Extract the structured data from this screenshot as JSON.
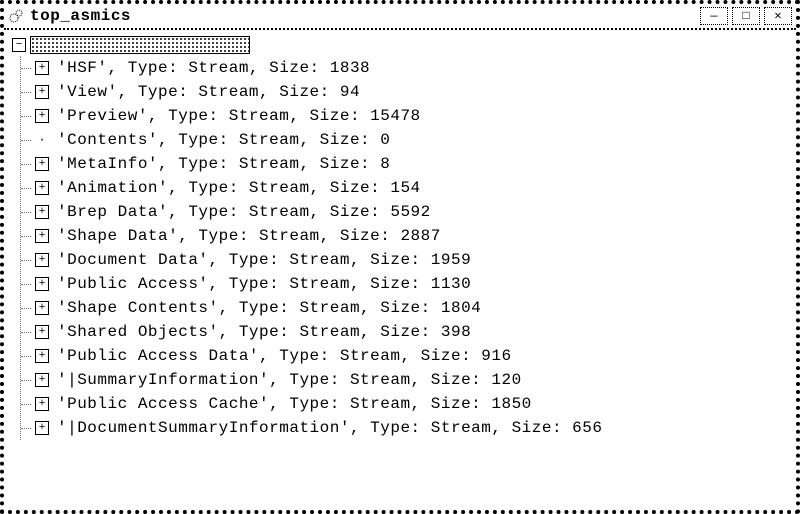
{
  "window": {
    "title": "top_asmics",
    "controls": {
      "min_glyph": "—",
      "max_glyph": "□",
      "close_glyph": "✕"
    }
  },
  "tree": {
    "root": {
      "expanded": true,
      "label": ""
    },
    "type_label": "Type",
    "size_label": "Size",
    "default_type": "Stream",
    "items": [
      {
        "name": "HSF",
        "type": "Stream",
        "size": 1838,
        "expandable": true
      },
      {
        "name": "View",
        "type": "Stream",
        "size": 94,
        "expandable": true
      },
      {
        "name": "Preview",
        "type": "Stream",
        "size": 15478,
        "expandable": true
      },
      {
        "name": "Contents",
        "type": "Stream",
        "size": 0,
        "expandable": false
      },
      {
        "name": "MetaInfo",
        "type": "Stream",
        "size": 8,
        "expandable": true
      },
      {
        "name": "Animation",
        "type": "Stream",
        "size": 154,
        "expandable": true
      },
      {
        "name": "Brep Data",
        "type": "Stream",
        "size": 5592,
        "expandable": true
      },
      {
        "name": "Shape Data",
        "type": "Stream",
        "size": 2887,
        "expandable": true
      },
      {
        "name": "Document Data",
        "type": "Stream",
        "size": 1959,
        "expandable": true
      },
      {
        "name": "Public Access",
        "type": "Stream",
        "size": 1130,
        "expandable": true
      },
      {
        "name": "Shape Contents",
        "type": "Stream",
        "size": 1804,
        "expandable": true
      },
      {
        "name": "Shared Objects",
        "type": "Stream",
        "size": 398,
        "expandable": true
      },
      {
        "name": "Public Access Data",
        "type": "Stream",
        "size": 916,
        "expandable": true
      },
      {
        "name": "|SummaryInformation",
        "type": "Stream",
        "size": 120,
        "expandable": true
      },
      {
        "name": "Public Access Cache",
        "type": "Stream",
        "size": 1850,
        "expandable": true
      },
      {
        "name": "|DocumentSummaryInformation",
        "type": "Stream",
        "size": 656,
        "expandable": true
      }
    ]
  }
}
